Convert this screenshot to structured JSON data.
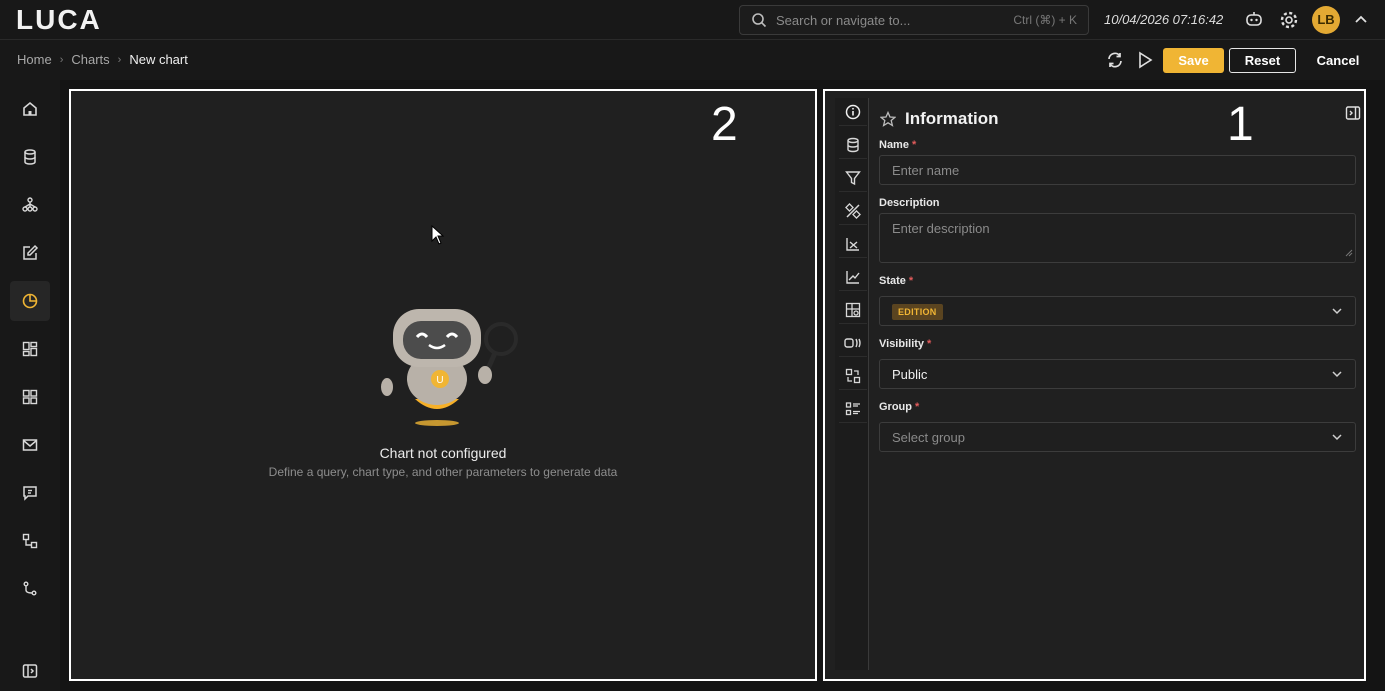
{
  "app": {
    "logo": "LUCA"
  },
  "search": {
    "placeholder": "Search or navigate to...",
    "shortcut": "Ctrl (⌘) + K"
  },
  "header": {
    "datetime": "10/04/2026 07:16:42",
    "avatar_initials": "LB"
  },
  "breadcrumb": {
    "home": "Home",
    "charts": "Charts",
    "current": "New chart"
  },
  "toolbar": {
    "save_label": "Save",
    "reset_label": "Reset",
    "cancel_label": "Cancel"
  },
  "preview": {
    "annotation": "2",
    "empty_title": "Chart not configured",
    "empty_subtitle": "Define a query, chart type, and other parameters to generate data"
  },
  "form": {
    "annotation": "1",
    "title": "Information",
    "name_label": "Name",
    "name_placeholder": "Enter name",
    "description_label": "Description",
    "description_placeholder": "Enter description",
    "state_label": "State",
    "state_value": "EDITION",
    "visibility_label": "Visibility",
    "visibility_value": "Public",
    "group_label": "Group",
    "group_placeholder": "Select group",
    "required_mark": "*"
  },
  "colors": {
    "accent": "#f0b534",
    "panel": "#202020",
    "background": "#141414"
  }
}
